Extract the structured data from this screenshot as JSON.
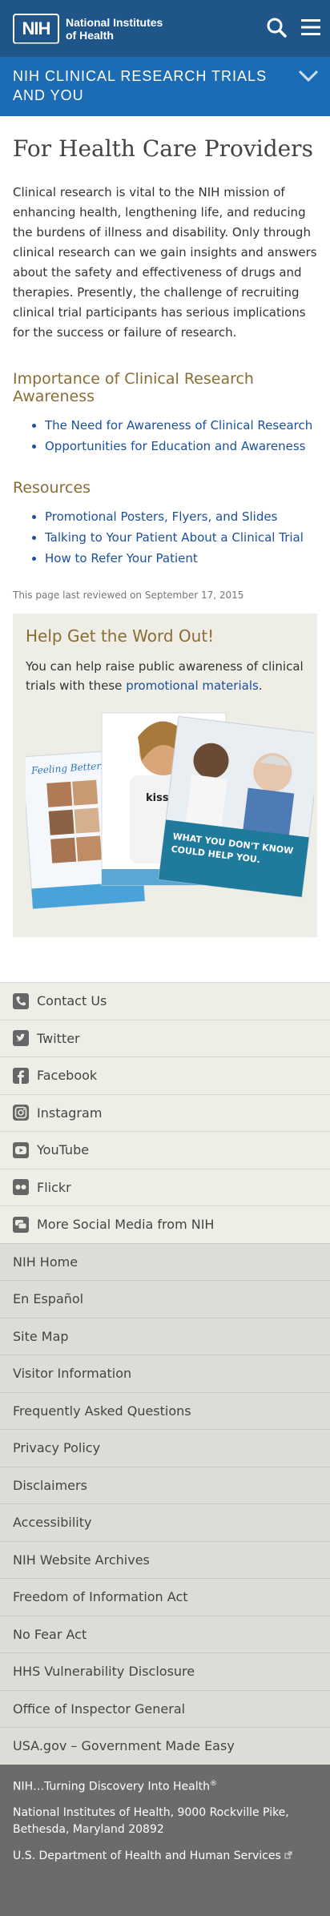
{
  "header": {
    "logo_mark": "NIH",
    "logo_line1": "National Institutes",
    "logo_line2": "of Health",
    "banner_title": "NIH Clinical Research Trials and You"
  },
  "page": {
    "title": "For Health Care Providers",
    "intro": "Clinical research is vital to the NIH mission of enhancing health, lengthening life, and reducing the burdens of illness and disability. Only through clinical research can we gain insights and answers about the safety and effectiveness of drugs and therapies. Presently, the challenge of recruiting clinical trial participants has serious implications for the success or failure of research.",
    "section1_title": "Importance of Clinical Research Awareness",
    "section1_links": [
      "The Need for Awareness of Clinical Research",
      "Opportunities for Education and Awareness"
    ],
    "section2_title": "Resources",
    "section2_links": [
      "Promotional Posters, Flyers, and Slides",
      "Talking to Your Patient About a Clinical Trial",
      "How to Refer Your Patient"
    ],
    "reviewed": "This page last reviewed on September 17, 2015"
  },
  "promo": {
    "title": "Help Get the Word Out!",
    "text_before": "You can help raise public awareness of clinical trials with these ",
    "link": "promotional materials",
    "text_after": ".",
    "poster_left_title": "Feeling Better...",
    "poster_mid_text": "kiss m asth",
    "poster_right_text_1": "WHAT YOU DON'T KNOW",
    "poster_right_text_2": "COULD HELP YOU."
  },
  "social": [
    {
      "label": "Contact Us",
      "icon": "phone-icon"
    },
    {
      "label": "Twitter",
      "icon": "twitter-icon"
    },
    {
      "label": "Facebook",
      "icon": "facebook-icon"
    },
    {
      "label": "Instagram",
      "icon": "instagram-icon"
    },
    {
      "label": "YouTube",
      "icon": "youtube-icon"
    },
    {
      "label": "Flickr",
      "icon": "flickr-icon"
    },
    {
      "label": "More Social Media from NIH",
      "icon": "chat-icon"
    }
  ],
  "footnav": [
    "NIH Home",
    "En Español",
    "Site Map",
    "Visitor Information",
    "Frequently Asked Questions",
    "Privacy Policy",
    "Disclaimers",
    "Accessibility",
    "NIH Website Archives",
    "Freedom of Information Act",
    "No Fear Act",
    "HHS Vulnerability Disclosure",
    "Office of Inspector General",
    "USA.gov – Government Made Easy"
  ],
  "footer": {
    "tagline": "NIH…Turning Discovery Into Health",
    "trademark": "®",
    "address": "National Institutes of Health, 9000 Rockville Pike, Bethesda, Maryland 20892",
    "hhs": "U.S. Department of Health and Human Services"
  }
}
